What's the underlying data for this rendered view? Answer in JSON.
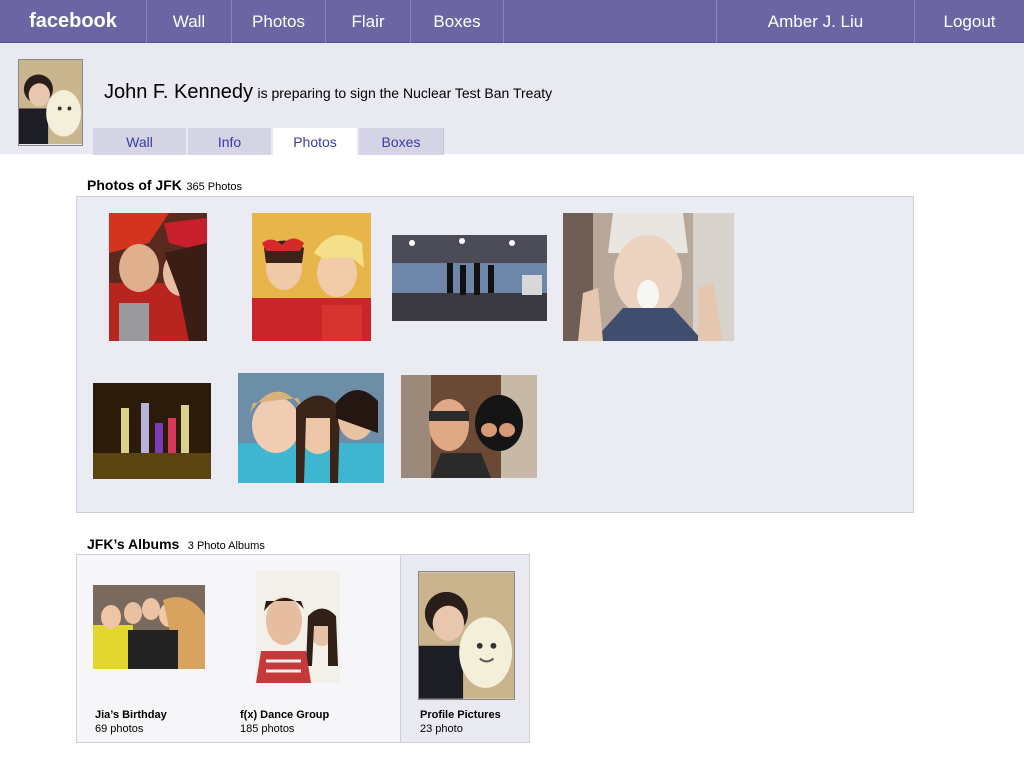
{
  "nav": {
    "logo": "facebook",
    "items": [
      "Wall",
      "Photos",
      "Flair",
      "Boxes"
    ],
    "user": "Amber J. Liu",
    "logout": "Logout",
    "bar_color": "#6b66a3"
  },
  "profile": {
    "name": "John F. Kennedy",
    "status": "is preparing to sign the Nuclear Test Ban Treaty",
    "tabs": [
      "Wall",
      "Info",
      "Photos",
      "Boxes"
    ],
    "active_tab": "Photos"
  },
  "photos_section": {
    "title": "Photos of JFK",
    "count": "365 Photos",
    "photo_icons": [
      "photo-icon",
      "photo-icon",
      "photo-icon",
      "photo-icon",
      "photo-icon",
      "photo-icon",
      "photo-icon"
    ]
  },
  "albums_section": {
    "title": "JFK’s Albums",
    "count": "3 Photo Albums",
    "albums": [
      {
        "name": "Jia’s Birthday",
        "count": "69 photos"
      },
      {
        "name": "f(x) Dance Group",
        "count": "185 photos"
      },
      {
        "name": "Profile Pictures",
        "count": "23 photo"
      }
    ]
  },
  "colors": {
    "link": "#3b3ba8",
    "panel": "#ebebf3",
    "header_bg": "#e9e9f1"
  }
}
